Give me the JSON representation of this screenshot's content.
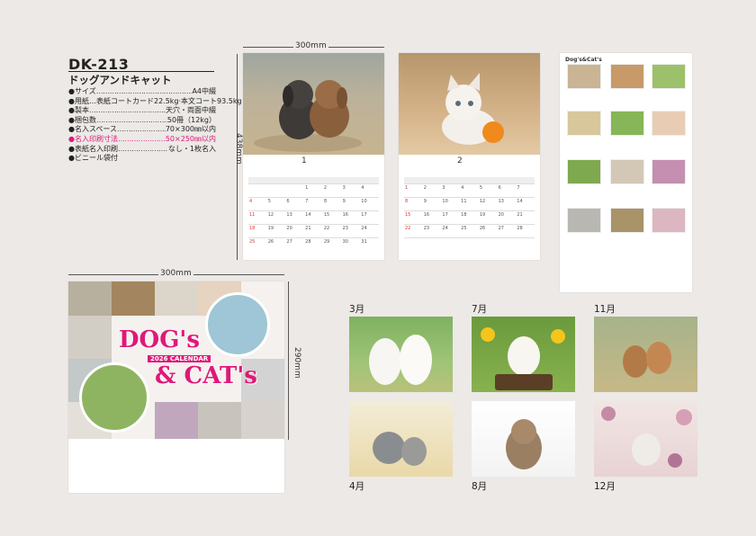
{
  "product": {
    "model": "DK-213",
    "name": "ドッグアンドキャット",
    "specs": [
      {
        "key": "●サイズ",
        "value": "A4中綴",
        "highlight": false
      },
      {
        "key": "●用紙…表紙コートカード22.5kg·本文コート93.5kg",
        "value": "",
        "highlight": false
      },
      {
        "key": "●製本",
        "value": "天穴・両面中綴",
        "highlight": false
      },
      {
        "key": "●梱包数",
        "value": "50冊（12kg）",
        "highlight": false
      },
      {
        "key": "●名入スペース",
        "value": "70×300㎜以内",
        "highlight": false
      },
      {
        "key": "●名入印刷寸法",
        "value": "50×250㎜以内",
        "highlight": true
      },
      {
        "key": "●表紙名入印刷",
        "value": "なし・1枚名入",
        "highlight": false
      },
      {
        "key": "●ビニール袋付",
        "value": "",
        "highlight": false
      }
    ]
  },
  "dimensions": {
    "top_width": "300mm",
    "top_height": "438mm",
    "bottom_width": "300mm",
    "bottom_height": "290mm"
  },
  "calendar_pages": {
    "month1": "1",
    "month2": "2",
    "overview_title": "Dog's&Cat's"
  },
  "cover": {
    "title_line1": "DOG's",
    "year_line": "2026 CALENDAR",
    "title_line2": "& CAT's"
  },
  "months": {
    "m3": "3月",
    "m4": "4月",
    "m7": "7月",
    "m8": "8月",
    "m11": "11月",
    "m12": "12月"
  },
  "colors": {
    "background": "#ece9e6",
    "accent_pink": "#e0187a"
  }
}
